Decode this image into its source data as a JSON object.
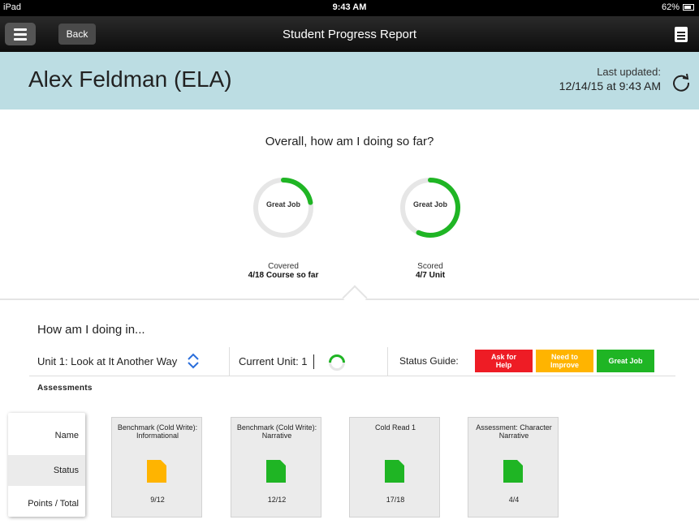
{
  "status_bar": {
    "device": "iPad",
    "time": "9:43 AM",
    "battery": "62%"
  },
  "nav": {
    "back_label": "Back",
    "title": "Student Progress Report"
  },
  "header": {
    "student_name": "Alex Feldman (ELA)",
    "updated_label": "Last updated:",
    "updated_value": "12/14/15 at 9:43 AM"
  },
  "overall": {
    "title": "Overall, how am I doing so far?",
    "metrics": [
      {
        "ring_label": "Great Job",
        "label": "Covered",
        "value": "4/18 Course so far",
        "fraction": 0.22,
        "color": "#1fb524"
      },
      {
        "ring_label": "Great Job",
        "label": "Scored",
        "value": "4/7 Unit",
        "fraction": 0.57,
        "color": "#1fb524"
      }
    ]
  },
  "doing": {
    "title": "How am I doing in...",
    "unit_select": "Unit 1: Look at It Another Way",
    "current_unit": "Current Unit: 1",
    "status_guide_label": "Status Guide:",
    "guide": [
      {
        "line1": "Ask for",
        "line2": "Help",
        "color": "#ee1c25"
      },
      {
        "line1": "Need to",
        "line2": "Improve",
        "color": "#ffb400"
      },
      {
        "line1": "Great Job",
        "line2": "",
        "color": "#1fb524"
      }
    ]
  },
  "assessments": {
    "title": "Assessments",
    "row_labels": [
      "Name",
      "Status",
      "Points / Total"
    ],
    "items": [
      {
        "name": "Benchmark (Cold Write): Informational",
        "points": "9/12",
        "status_color": "#ffb400"
      },
      {
        "name": "Benchmark (Cold Write): Narrative",
        "points": "12/12",
        "status_color": "#1fb524"
      },
      {
        "name": "Cold Read 1",
        "points": "17/18",
        "status_color": "#1fb524"
      },
      {
        "name": "Assessment: Character Narrative",
        "points": "4/4",
        "status_color": "#1fb524"
      }
    ]
  },
  "colors": {
    "header_bg": "#bcdde3",
    "ring_track": "#e6e6e6",
    "ring_progress": "#1fb524",
    "accent_blue": "#2a6edb"
  }
}
